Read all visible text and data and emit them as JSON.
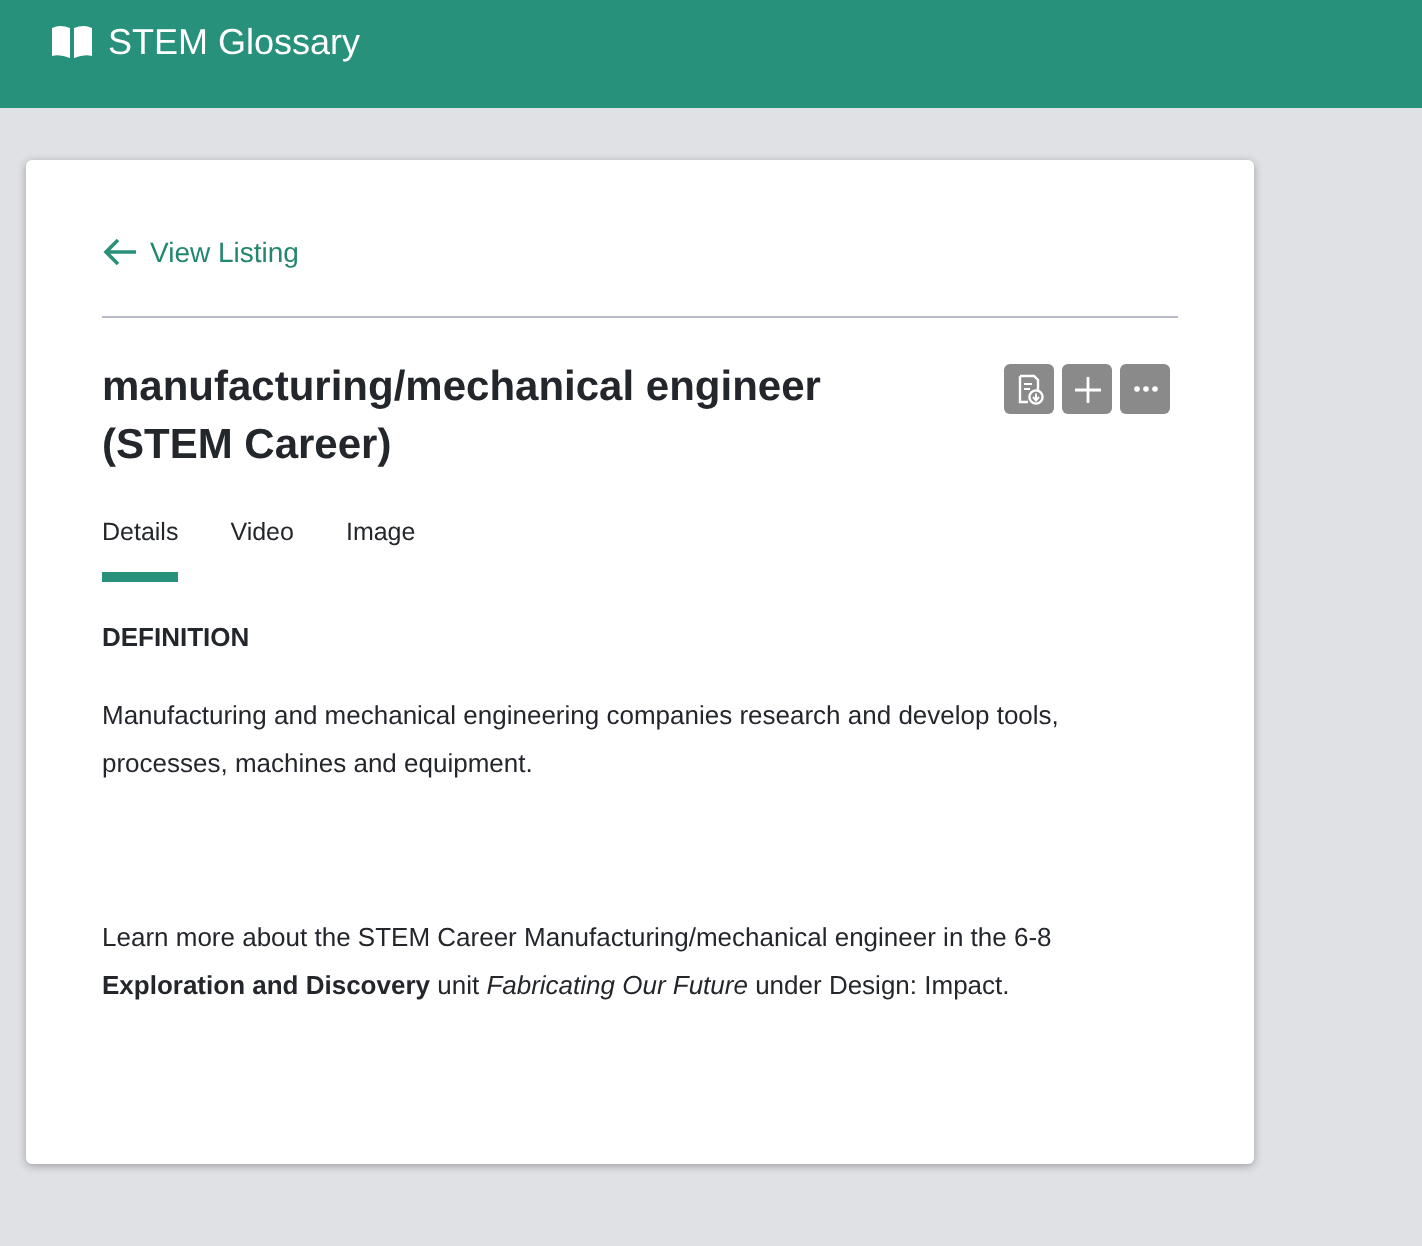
{
  "header": {
    "title": "STEM Glossary"
  },
  "back_link": "View Listing",
  "term": {
    "title": "manufacturing/mechanical engineer (STEM Career)"
  },
  "actions": [
    {
      "kind": "document"
    },
    {
      "kind": "add"
    },
    {
      "kind": "more"
    }
  ],
  "tabs": [
    {
      "label": "Details",
      "selected": true
    },
    {
      "label": "Video",
      "selected": false
    },
    {
      "label": "Image",
      "selected": false
    }
  ],
  "section_heading": "DEFINITION",
  "definition": "Manufacturing and mechanical engineering companies research and develop tools, processes, machines and equipment.",
  "learn_more": "Learn more about the STEM Career Manufacturing/mechanical engineer in the 6-8 **Exploration and Discovery** unit *Fabricating Our Future* under Design: Impact."
}
